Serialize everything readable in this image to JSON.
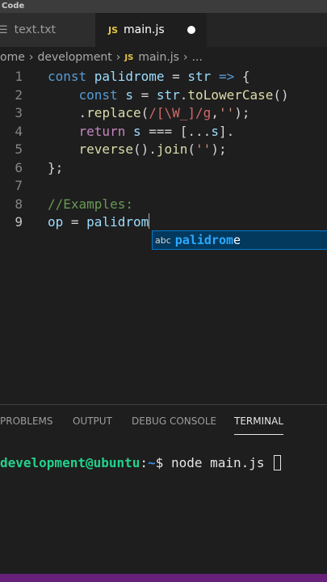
{
  "window": {
    "title": "Code"
  },
  "tabs": [
    {
      "icon": "lines-icon",
      "label": "text.txt",
      "active": false
    },
    {
      "icon": "js-icon",
      "icon_text": "JS",
      "label": "main.js",
      "active": true,
      "modified": true
    }
  ],
  "breadcrumb": {
    "items": [
      "ome",
      "development"
    ],
    "file_icon_text": "JS",
    "file": "main.js",
    "more": "..."
  },
  "editor": {
    "lines": [
      {
        "number": "1",
        "tokens": [
          {
            "t": "const ",
            "c": "kw"
          },
          {
            "t": "palidrome",
            "c": "var"
          },
          {
            "t": " = ",
            "c": "plain"
          },
          {
            "t": "str",
            "c": "var"
          },
          {
            "t": " ",
            "c": "plain"
          },
          {
            "t": "=>",
            "c": "kw"
          },
          {
            "t": " {",
            "c": "plain"
          }
        ]
      },
      {
        "number": "2",
        "tokens": [
          {
            "t": "    ",
            "c": "plain"
          },
          {
            "t": "const ",
            "c": "kw"
          },
          {
            "t": "s",
            "c": "var"
          },
          {
            "t": " = ",
            "c": "plain"
          },
          {
            "t": "str",
            "c": "var"
          },
          {
            "t": ".",
            "c": "plain"
          },
          {
            "t": "toLowerCase",
            "c": "fn"
          },
          {
            "t": "()",
            "c": "plain"
          }
        ]
      },
      {
        "number": "3",
        "tokens": [
          {
            "t": "    .",
            "c": "plain"
          },
          {
            "t": "replace",
            "c": "fn"
          },
          {
            "t": "(",
            "c": "plain"
          },
          {
            "t": "/[\\W_]/g",
            "c": "re"
          },
          {
            "t": ",",
            "c": "plain"
          },
          {
            "t": "''",
            "c": "str"
          },
          {
            "t": ");",
            "c": "plain"
          }
        ]
      },
      {
        "number": "4",
        "tokens": [
          {
            "t": "    ",
            "c": "plain"
          },
          {
            "t": "return ",
            "c": "kw2"
          },
          {
            "t": "s",
            "c": "var"
          },
          {
            "t": " === [...",
            "c": "plain"
          },
          {
            "t": "s",
            "c": "var"
          },
          {
            "t": "].",
            "c": "plain"
          }
        ]
      },
      {
        "number": "5",
        "tokens": [
          {
            "t": "    ",
            "c": "plain"
          },
          {
            "t": "reverse",
            "c": "fn"
          },
          {
            "t": "().",
            "c": "plain"
          },
          {
            "t": "join",
            "c": "fn"
          },
          {
            "t": "(",
            "c": "plain"
          },
          {
            "t": "''",
            "c": "str"
          },
          {
            "t": ");",
            "c": "plain"
          }
        ]
      },
      {
        "number": "6",
        "tokens": [
          {
            "t": "};",
            "c": "plain"
          }
        ]
      },
      {
        "number": "7",
        "tokens": []
      },
      {
        "number": "8",
        "tokens": [
          {
            "t": "//Examples:",
            "c": "cmt"
          }
        ]
      },
      {
        "number": "9",
        "current": true,
        "cursor": true,
        "tokens": [
          {
            "t": "op",
            "c": "var"
          },
          {
            "t": " = ",
            "c": "plain"
          },
          {
            "t": "palidrom",
            "c": "var"
          }
        ]
      }
    ]
  },
  "suggestion": {
    "kind_label": "abc",
    "match": "palidrom",
    "rest": "e"
  },
  "panel": {
    "tabs": [
      {
        "label": "PROBLEMS",
        "active": false
      },
      {
        "label": "OUTPUT",
        "active": false
      },
      {
        "label": "DEBUG CONSOLE",
        "active": false
      },
      {
        "label": "TERMINAL",
        "active": true
      }
    ],
    "terminal": {
      "user": "development@ubuntu",
      "path_sep": ":",
      "path": "~",
      "prompt": "$ ",
      "command": "node main.js "
    }
  },
  "colors": {
    "statusbar": "#68217a",
    "editor_bg": "#1e1e1e",
    "suggest_bg": "#04395e"
  }
}
